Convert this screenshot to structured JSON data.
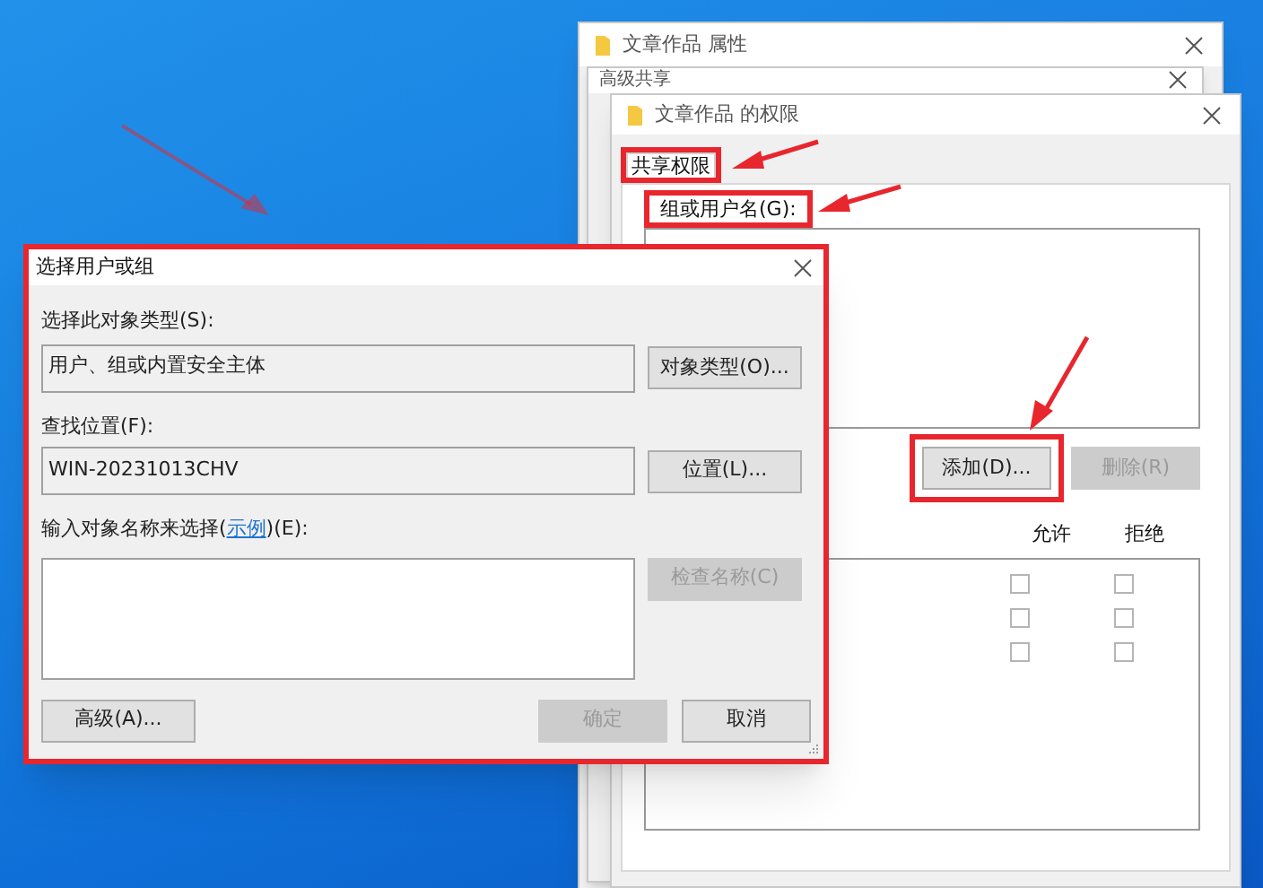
{
  "properties_window": {
    "title": "文章作品 属性"
  },
  "advanced_sharing_window": {
    "title": "高级共享"
  },
  "permissions_window": {
    "title": "文章作品 的权限",
    "tabs": [
      {
        "label": "共享权限",
        "selected": true,
        "highlighted": true
      }
    ],
    "group_label": {
      "text": "组或用户名(G):",
      "highlighted": true
    },
    "buttons": [
      {
        "label": "添加(D)...",
        "disabled": false,
        "highlighted": true
      },
      {
        "label": "删除(R)",
        "disabled": true,
        "highlighted": false
      }
    ],
    "columns": [
      "允许",
      "拒绝"
    ],
    "permissions": [
      {
        "allow": false,
        "deny": false
      },
      {
        "allow": false,
        "deny": false
      },
      {
        "allow": false,
        "deny": false
      }
    ]
  },
  "select_dialog": {
    "title": "选择用户或组",
    "highlighted": true,
    "object_type_label": "选择此对象类型(S):",
    "object_type_value": "用户、组或内置安全主体",
    "object_type_button": "对象类型(O)...",
    "location_label": "查找位置(F):",
    "location_value": "WIN-20231013CHV",
    "location_button": "位置(L)...",
    "name_label_before": "输入对象名称来选择(",
    "name_label_link": "示例",
    "name_label_after": ")(E):",
    "check_names_button": {
      "label": "检查名称(C)",
      "disabled": true
    },
    "buttons": [
      {
        "label": "高级(A)...",
        "disabled": false
      },
      {
        "label": "确定",
        "disabled": true
      },
      {
        "label": "取消",
        "disabled": false
      }
    ]
  }
}
